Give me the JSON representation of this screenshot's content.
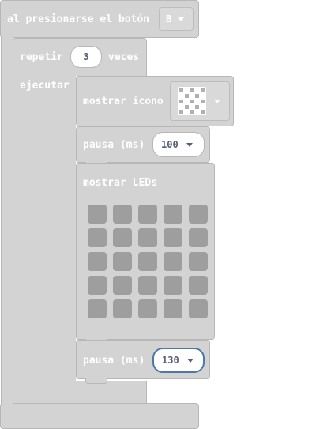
{
  "event_block": {
    "label": "al presionarse el botón",
    "button_value": "B"
  },
  "repeat_block": {
    "label_repeat": "repetir",
    "count": "3",
    "label_times": "veces",
    "label_do": "ejecutar"
  },
  "show_icon_block": {
    "label": "mostrar icono",
    "icon": "icon-preview"
  },
  "pause_block_1": {
    "label": "pausa (ms)",
    "value": "100"
  },
  "show_leds_block": {
    "label": "mostrar LEDs",
    "rows": 5,
    "cols": 5,
    "lit": []
  },
  "pause_block_2": {
    "label": "pausa (ms)",
    "value": "130"
  },
  "colors": {
    "block": "#d3d3d3",
    "block_border": "#b7b7b7",
    "led_off": "#9e9e9e",
    "input_focus": "#4d78a8"
  }
}
